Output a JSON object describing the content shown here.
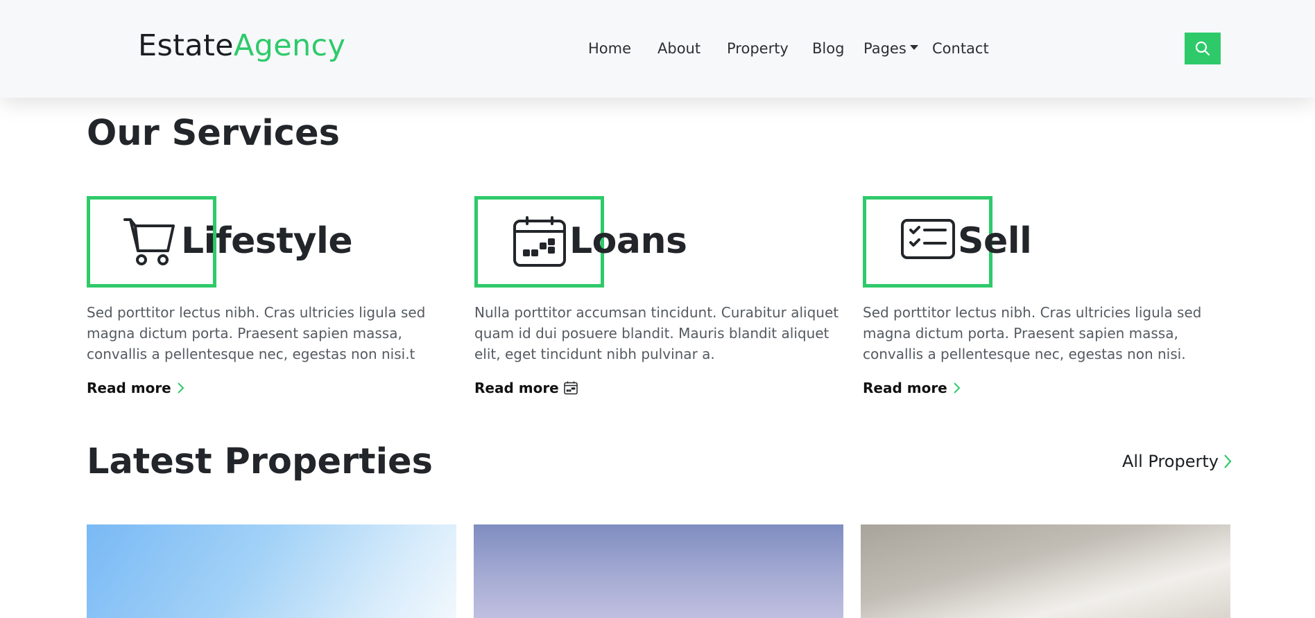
{
  "brand": {
    "part1": "Estate",
    "part2": "Agency"
  },
  "nav": {
    "items": [
      {
        "label": "Home"
      },
      {
        "label": "About"
      },
      {
        "label": "Property"
      },
      {
        "label": "Blog"
      },
      {
        "label": "Pages"
      },
      {
        "label": "Contact"
      }
    ],
    "search_icon": "search-icon"
  },
  "services": {
    "title": "Our Services",
    "cards": [
      {
        "title": "Lifestyle",
        "icon": "cart-icon",
        "text": "Sed porttitor lectus nibh. Cras ultricies ligula sed magna dictum porta. Praesent sapien massa, convallis a pellentesque nec, egestas non nisi.t",
        "link": "Read more",
        "link_icon": "chevron-right-icon"
      },
      {
        "title": "Loans",
        "icon": "calendar-icon",
        "text": "Nulla porttitor accumsan tincidunt. Curabitur aliquet quam id dui posuere blandit. Mauris blandit aliquet elit, eget tincidunt nibh pulvinar a.",
        "link": "Read more",
        "link_icon": "calendar-icon"
      },
      {
        "title": "Sell",
        "icon": "checklist-card-icon",
        "text": "Sed porttitor lectus nibh. Cras ultricies ligula sed magna dictum porta. Praesent sapien massa, convallis a pellentesque nec, egestas non nisi.",
        "link": "Read more",
        "link_icon": "chevron-right-icon"
      }
    ]
  },
  "latest": {
    "title": "Latest Properties",
    "all_link": "All Property"
  },
  "colors": {
    "accent": "#2eca6a",
    "text": "#222529",
    "muted": "#555a60",
    "navbar_bg": "#f7f8fa"
  }
}
